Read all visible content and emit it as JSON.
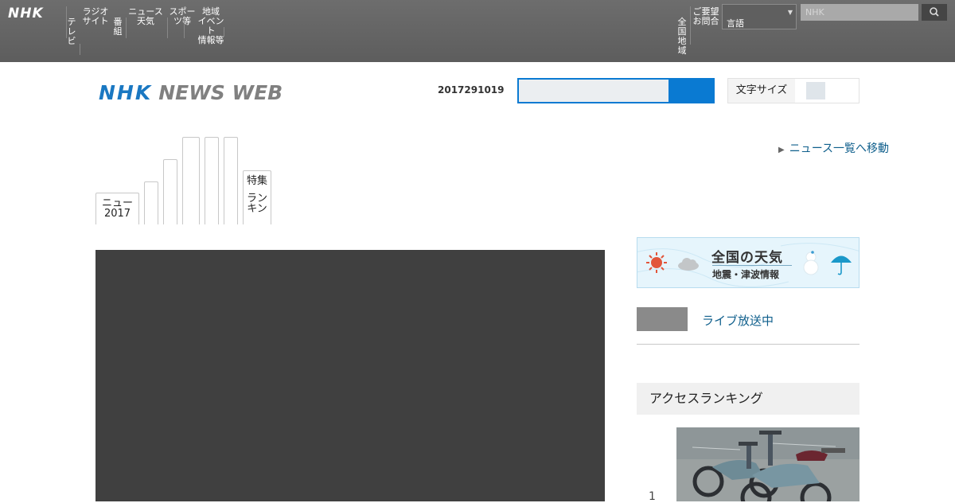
{
  "global_bar": {
    "logo": "NHK",
    "nav_items": [
      "テレ\nビ",
      "ラジオ\nサイト",
      "番組",
      "ニュース\n天気",
      "スポー\nツ等",
      "地域\nイベント\n情報等"
    ],
    "right_items": [
      "全国\n地域",
      "ご要望\nお問合"
    ],
    "language_value": "言語",
    "search_placeholder": "NHK"
  },
  "header": {
    "logo_nhk": "NHK",
    "logo_news": "NEWS WEB",
    "date": "2017291019",
    "text_size_label": "文字サイズ"
  },
  "news_tabs": {
    "first": "ニュー\n2017",
    "last_top": "特集",
    "last_bottom": "ラン\nキン",
    "more_link": "ニュース一覧へ移動"
  },
  "sidebar": {
    "weather_title": "全国の天気",
    "weather_sub": "地震・津波情報",
    "live_link": "ライブ放送中",
    "ranking_title": "アクセスランキング",
    "rank_number": "1"
  },
  "colors": {
    "accent_blue": "#0a7ad2",
    "link_blue": "#0f5f8c",
    "global_bar": "#666666"
  },
  "icons": [
    "search-icon",
    "chevron-down-icon",
    "sun-icon",
    "cloud-icon",
    "snowman-icon",
    "umbrella-icon",
    "triangle-right-icon"
  ]
}
